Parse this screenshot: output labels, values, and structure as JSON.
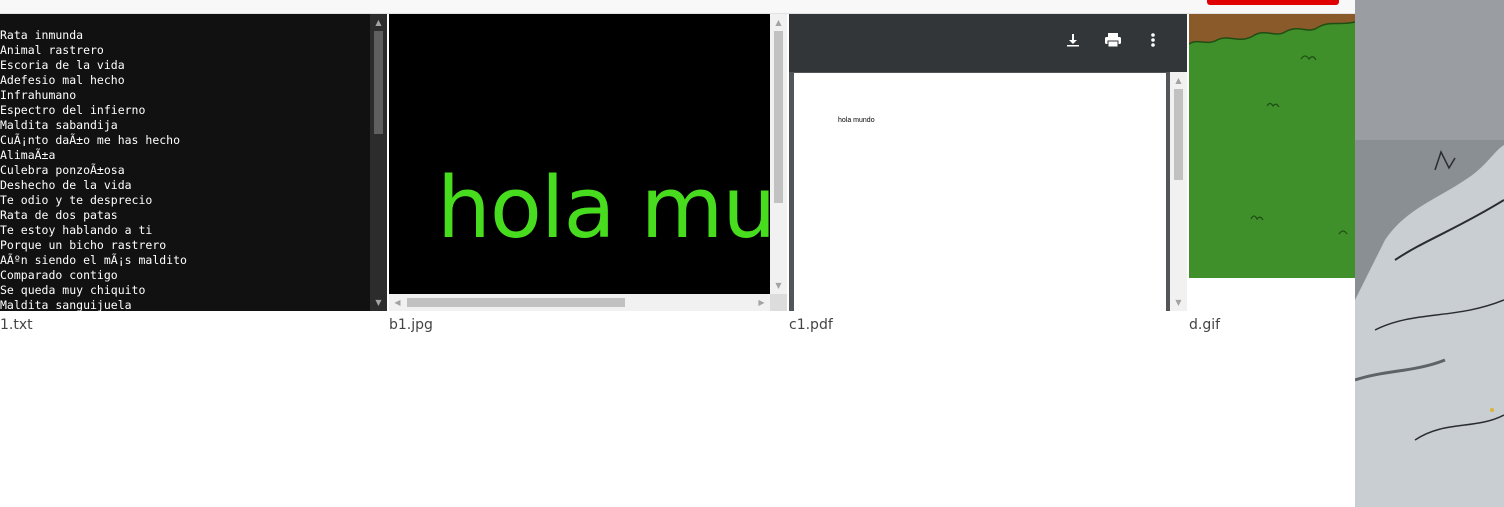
{
  "text_file": {
    "lines": [
      "Rata inmunda",
      "Animal rastrero",
      "Escoria de la vida",
      "Adefesio mal hecho",
      "Infrahumano",
      "Espectro del infierno",
      "Maldita sabandija",
      "CuÃ¡nto daÃ±o me has hecho",
      "AlimaÃ±a",
      "Culebra ponzoÃ±osa",
      "Deshecho de la vida",
      "Te odio y te desprecio",
      "Rata de dos patas",
      "Te estoy hablando a ti",
      "Porque un bicho rastrero",
      "AÃºn siendo el mÃ¡s maldito",
      "Comparado contigo",
      "Se queda muy chiquito",
      "Maldita sanguijuela"
    ],
    "caption": "1.txt"
  },
  "image_file": {
    "preview_text": "hola mundo",
    "caption": "b1.jpg"
  },
  "pdf_file": {
    "page_text": "hola mundo",
    "caption": "c1.pdf"
  },
  "gif_file": {
    "caption": "d.gif"
  },
  "icons": {
    "download": "download-icon",
    "print": "print-icon",
    "more": "more-vert-icon"
  },
  "colors": {
    "text_panel_bg": "#111111",
    "image_text_green": "#47dc1e",
    "pdf_toolbar": "#323639",
    "gif_grass": "#3f8f2a",
    "top_button_red": "#e00000"
  }
}
